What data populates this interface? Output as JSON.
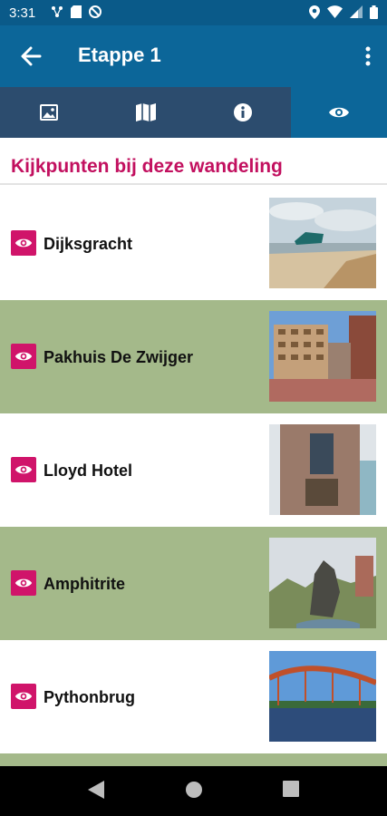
{
  "status_bar": {
    "time": "3:31"
  },
  "header": {
    "title": "Etappe 1"
  },
  "tabs": [
    {
      "icon": "image-icon"
    },
    {
      "icon": "map-icon"
    },
    {
      "icon": "info-icon"
    },
    {
      "icon": "eye-icon",
      "selected": true
    }
  ],
  "section": {
    "title": "Kijkpunten bij deze wandeling"
  },
  "items": [
    {
      "label": "Dijksgracht"
    },
    {
      "label": "Pakhuis De Zwijger"
    },
    {
      "label": "Lloyd Hotel"
    },
    {
      "label": "Amphitrite"
    },
    {
      "label": "Pythonbrug"
    }
  ],
  "colors": {
    "primary": "#0c6699",
    "tab_inactive": "#2c4c6e",
    "accent": "#c2105f",
    "row_alt": "#a4b98a"
  }
}
